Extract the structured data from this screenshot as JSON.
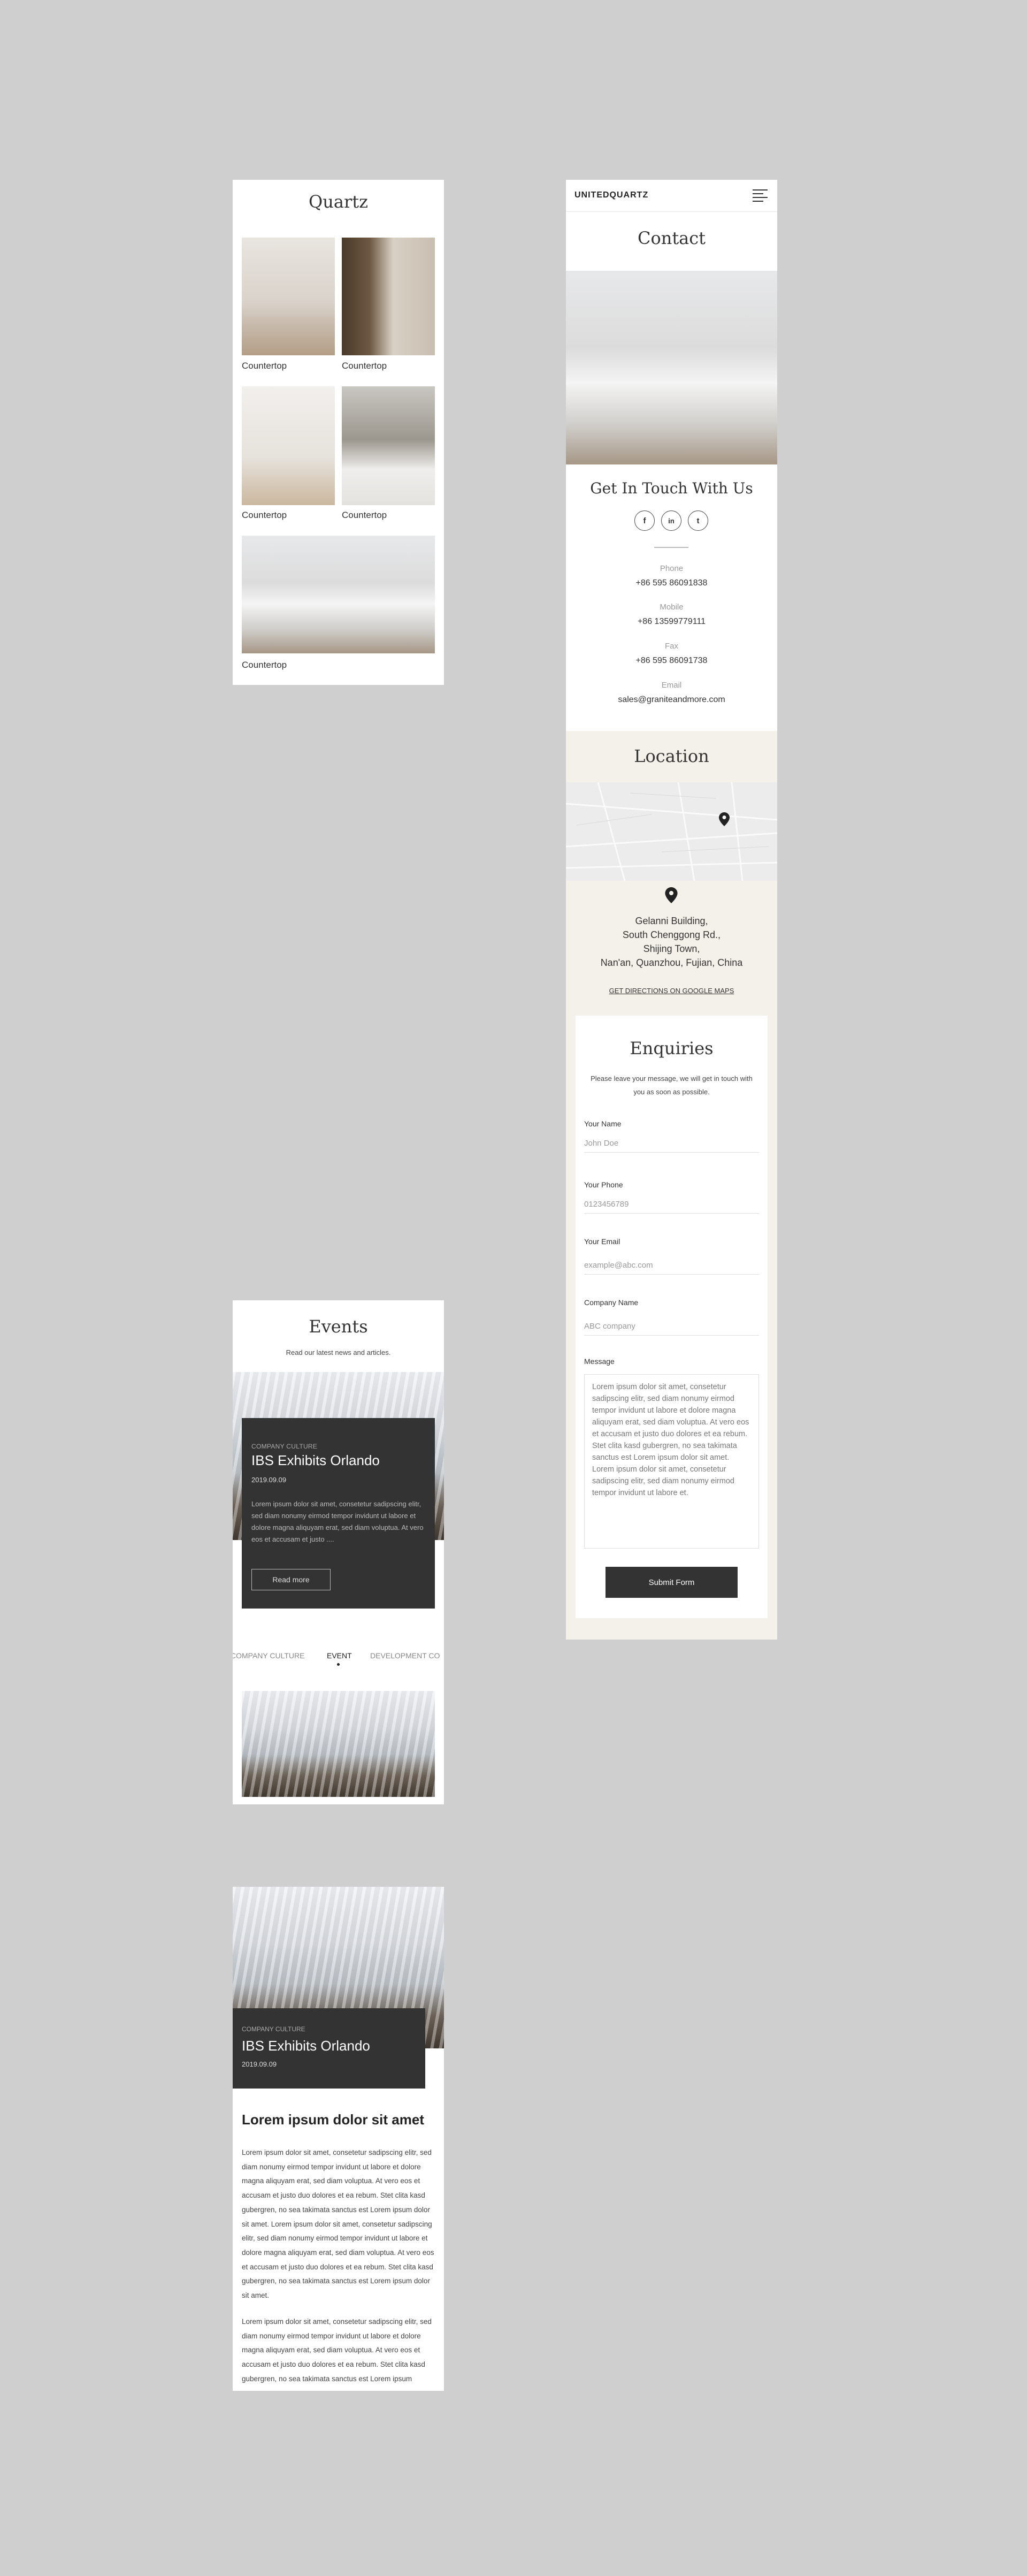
{
  "quartz": {
    "title": "Quartz",
    "items": [
      {
        "label": "Countertop"
      },
      {
        "label": "Countertop"
      },
      {
        "label": "Countertop"
      },
      {
        "label": "Countertop"
      },
      {
        "label": "Countertop"
      }
    ]
  },
  "events": {
    "title": "Events",
    "subtitle": "Read our latest news and articles.",
    "card": {
      "category": "COMPANY CULTURE",
      "title": "IBS Exhibits Orlando",
      "date": "2019.09.09",
      "excerpt": "Lorem ipsum dolor sit amet, consetetur sadipscing elitr, sed diam nonumy eirmod tempor invidunt ut labore et dolore magna aliquyam erat, sed diam voluptua. At vero eos et accusam et justo ....",
      "button": "Read more"
    },
    "tabs": [
      {
        "label": "COMPANY CULTURE",
        "active": false
      },
      {
        "label": "EVENT",
        "active": true
      },
      {
        "label": "DEVELOPMENT CO",
        "active": false
      }
    ]
  },
  "article": {
    "category": "COMPANY CULTURE",
    "title": "IBS Exhibits Orlando",
    "date": "2019.09.09",
    "heading": "Lorem ipsum dolor sit amet",
    "paragraph1": "Lorem ipsum dolor sit amet, consetetur sadipscing elitr, sed diam nonumy eirmod tempor invidunt ut labore et dolore magna aliquyam erat, sed diam voluptua. At vero eos et accusam et justo duo dolores et ea rebum. Stet clita kasd gubergren, no sea takimata sanctus est Lorem ipsum dolor sit amet. Lorem ipsum dolor sit amet, consetetur sadipscing elitr, sed diam nonumy eirmod tempor invidunt ut labore et dolore magna aliquyam erat, sed diam voluptua. At vero eos et accusam et justo duo dolores et ea rebum. Stet clita kasd gubergren, no sea takimata sanctus est Lorem ipsum dolor sit amet.",
    "paragraph2": "Lorem ipsum dolor sit amet, consetetur sadipscing elitr, sed diam nonumy eirmod tempor invidunt ut labore et dolore magna aliquyam erat, sed diam voluptua. At vero eos et accusam et justo duo dolores et ea rebum. Stet clita kasd gubergren, no sea takimata sanctus est Lorem ipsum"
  },
  "contact": {
    "brand": "UNITEDQUARTZ",
    "title": "Contact",
    "get_in_touch": "Get In Touch With Us",
    "social": [
      {
        "icon": "facebook-icon",
        "glyph": "f"
      },
      {
        "icon": "linkedin-icon",
        "glyph": "in"
      },
      {
        "icon": "twitter-icon",
        "glyph": "t"
      }
    ],
    "phone_label": "Phone",
    "phone": "+86 595 86091838",
    "mobile_label": "Mobile",
    "mobile": "+86 13599779111",
    "fax_label": "Fax",
    "fax": "+86 595 86091738",
    "email_label": "Email",
    "email": "sales@graniteandmore.com",
    "location_title": "Location",
    "address": [
      "Gelanni Building,",
      "South Chenggong Rd.,",
      "Shijing Town,",
      "Nan'an, Quanzhou, Fujian, China"
    ],
    "directions": "GET DIRECTIONS ON GOOGLE MAPS",
    "enquiries": {
      "title": "Enquiries",
      "intro": "Please leave your message, we will get in touch with you as soon as possible.",
      "name_label": "Your Name",
      "name_placeholder": "John Doe",
      "phone_label": "Your Phone",
      "phone_placeholder": "0123456789",
      "email_label": "Your Email",
      "email_placeholder": "example@abc.com",
      "company_label": "Company Name",
      "company_placeholder": "ABC company",
      "message_label": "Message",
      "message_value": "Lorem ipsum dolor sit amet, consetetur sadipscing elitr, sed diam nonumy eirmod tempor invidunt ut labore et dolore magna aliquyam erat, sed diam voluptua. At vero eos et accusam et justo duo dolores et ea rebum. Stet clita kasd gubergren, no sea takimata sanctus est Lorem ipsum dolor sit amet. Lorem ipsum dolor sit amet, consetetur sadipscing elitr, sed diam nonumy eirmod tempor invidunt ut labore et.",
      "submit": "Submit Form"
    }
  },
  "colors": {
    "background": "#cfcfcf",
    "dark": "#333333",
    "beige": "#f4f1ea"
  }
}
